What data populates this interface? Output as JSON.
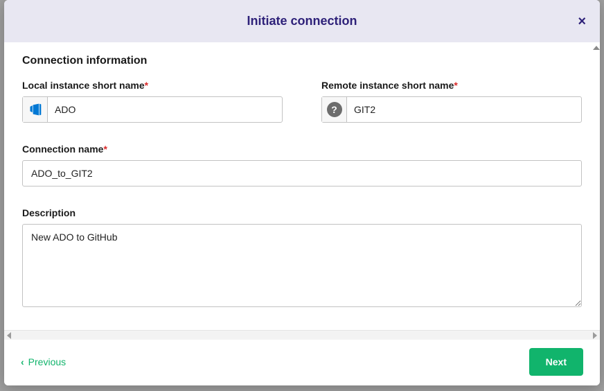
{
  "modal": {
    "title": "Initiate connection",
    "close_label": "×"
  },
  "section": {
    "title": "Connection information"
  },
  "fields": {
    "local_short": {
      "label": "Local instance short name",
      "value": "ADO"
    },
    "remote_short": {
      "label": "Remote instance short name",
      "value": "GIT2"
    },
    "connection_name": {
      "label": "Connection name",
      "value": "ADO_to_GIT2"
    },
    "description": {
      "label": "Description",
      "value": "New ADO to GitHub"
    }
  },
  "footer": {
    "previous": "Previous",
    "next": "Next"
  },
  "required_marker": "*"
}
